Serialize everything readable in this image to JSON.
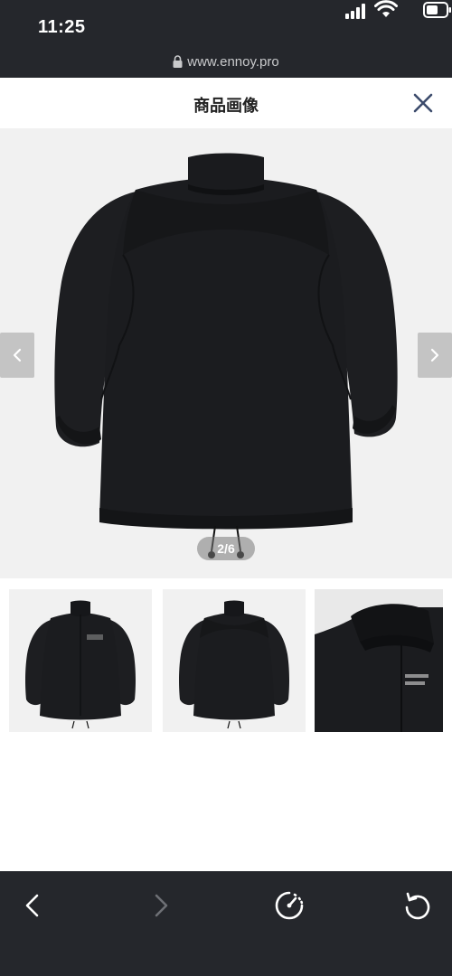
{
  "status_bar": {
    "time": "11:25",
    "url": "www.ennoy.pro"
  },
  "header": {
    "title": "商品画像"
  },
  "viewer": {
    "counter": "2/6",
    "image_alt": "jacket back view"
  },
  "thumbnails": [
    {
      "label": "jacket front view"
    },
    {
      "label": "jacket back view"
    },
    {
      "label": "jacket collar detail"
    }
  ],
  "colors": {
    "chrome_dark": "#25272c",
    "viewer_bg": "#f1f1f1",
    "nav_arrow_bg": "#c4c4c4",
    "jacket": "#1b1c1f"
  },
  "toolbar": {
    "icons": [
      "chevron-left-icon",
      "chevron-right-icon",
      "speedometer-icon",
      "reload-icon"
    ]
  }
}
